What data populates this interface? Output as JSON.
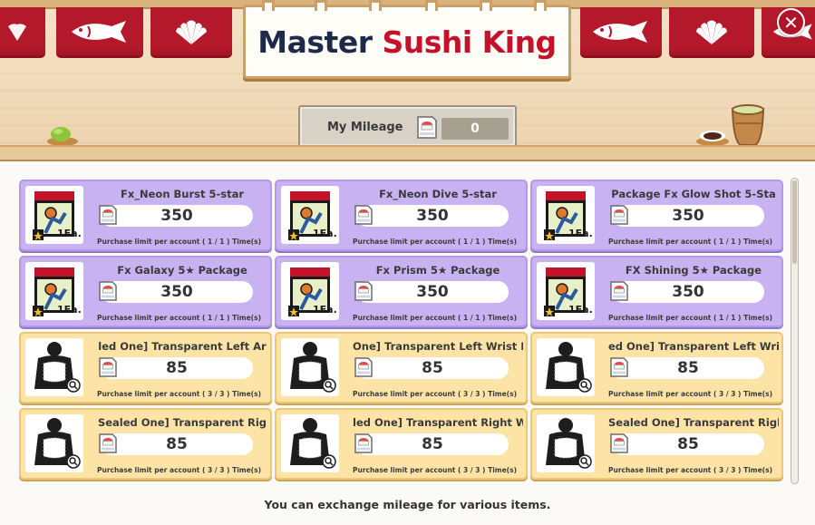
{
  "window": {
    "title_part1": "Master",
    "title_part2": "Sushi King",
    "close_label": "✕"
  },
  "mileage": {
    "label": "My Mileage",
    "value": "0",
    "icon": "sushi-coin-icon"
  },
  "items": [
    {
      "name": "Fx_Neon Burst 5-star",
      "price": "350",
      "quantity": "1Ea.",
      "limit": "Purchase limit per account ( 1 / 1 ) Time(s)",
      "theme": "purple",
      "icon": "basketball-card-icon"
    },
    {
      "name": "Fx_Neon Dive 5-star",
      "price": "350",
      "quantity": "1Ea.",
      "limit": "Purchase limit per account ( 1 / 1 ) Time(s)",
      "theme": "purple",
      "icon": "basketball-card-icon"
    },
    {
      "name": "Package    Fx Glow Shot 5-Sta",
      "price": "350",
      "quantity": "1Ea.",
      "limit": "Purchase limit per account ( 1 / 1 ) Time(s)",
      "theme": "purple",
      "icon": "basketball-card-icon"
    },
    {
      "name": "Fx Galaxy 5★ Package",
      "price": "350",
      "quantity": "1Ea.",
      "limit": "Purchase limit per account ( 1 / 1 ) Time(s)",
      "theme": "purple",
      "icon": "basketball-card-icon"
    },
    {
      "name": "Fx Prism 5★ Package",
      "price": "350",
      "quantity": "1Ea.",
      "limit": "Purchase limit per account ( 1 / 1 ) Time(s)",
      "theme": "purple",
      "icon": "basketball-card-icon"
    },
    {
      "name": "FX Shining 5★ Package",
      "price": "350",
      "quantity": "1Ea.",
      "limit": "Purchase limit per account ( 1 / 1 ) Time(s)",
      "theme": "purple",
      "icon": "basketball-card-icon"
    },
    {
      "name": "led One] Transparent Left Ar",
      "price": "85",
      "quantity": "",
      "limit": "Purchase limit per account ( 3 / 3 ) Time(s)",
      "theme": "yellow",
      "icon": "armband-silhouette-icon"
    },
    {
      "name": "One] Transparent Left Wrist E",
      "price": "85",
      "quantity": "",
      "limit": "Purchase limit per account ( 3 / 3 ) Time(s)",
      "theme": "yellow",
      "icon": "armband-silhouette-icon"
    },
    {
      "name": "ed One] Transparent Left Wri",
      "price": "85",
      "quantity": "",
      "limit": "Purchase limit per account ( 3 / 3 ) Time(s)",
      "theme": "yellow",
      "icon": "armband-silhouette-icon"
    },
    {
      "name": "Sealed One] Transparent Rig",
      "price": "85",
      "quantity": "",
      "limit": "Purchase limit per account ( 3 / 3 ) Time(s)",
      "theme": "yellow",
      "icon": "armband-silhouette-icon"
    },
    {
      "name": "led One] Transparent Right W",
      "price": "85",
      "quantity": "",
      "limit": "Purchase limit per account ( 3 / 3 ) Time(s)",
      "theme": "yellow",
      "icon": "armband-silhouette-icon"
    },
    {
      "name": "Sealed One] Transparent Righ",
      "price": "85",
      "quantity": "",
      "limit": "Purchase limit per account ( 3 / 3 ) Time(s)",
      "theme": "yellow",
      "icon": "armband-silhouette-icon"
    }
  ],
  "footer": {
    "text": "You can exchange mileage for various items."
  },
  "colors": {
    "accent_red": "#b3192a",
    "purple_card": "#c9b2f1",
    "yellow_card": "#fde4a6"
  }
}
